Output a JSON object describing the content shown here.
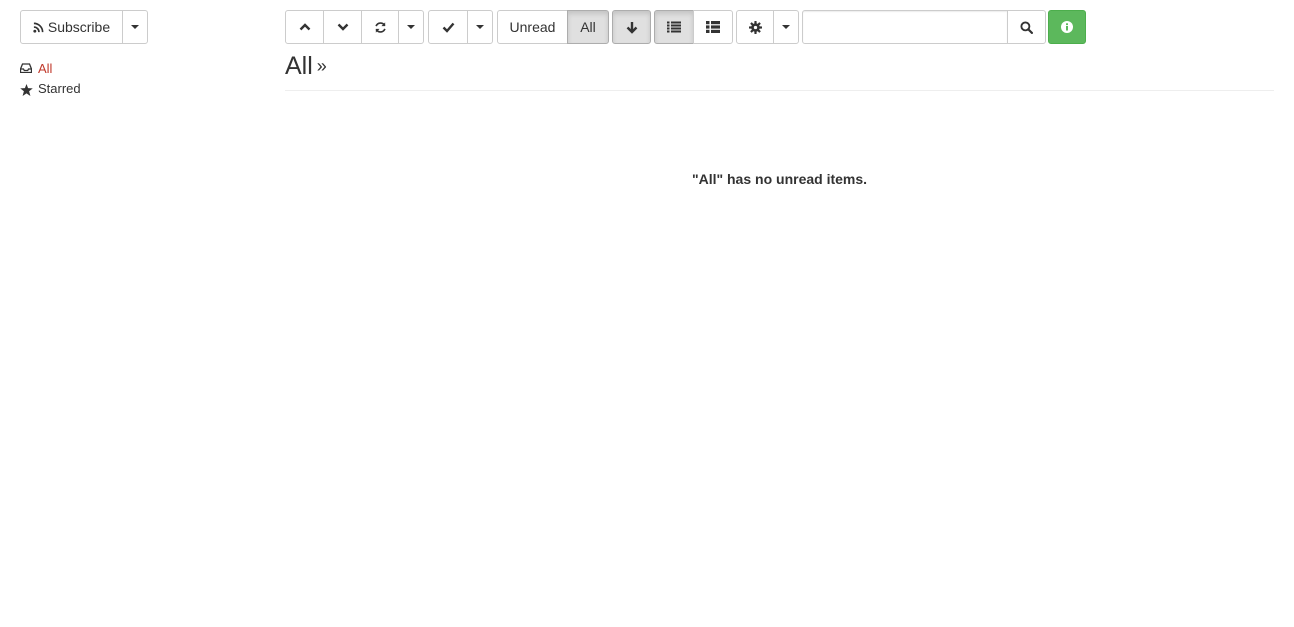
{
  "toolbar": {
    "subscribe_label": "Subscribe",
    "filter_unread_label": "Unread",
    "filter_all_label": "All",
    "search_placeholder": ""
  },
  "sidebar": {
    "items": [
      {
        "label": "All",
        "icon": "inbox-icon",
        "active": true
      },
      {
        "label": "Starred",
        "icon": "star-icon",
        "active": false
      }
    ]
  },
  "main": {
    "title": "All",
    "title_separator": "»",
    "empty_message": "\"All\" has no unread items."
  },
  "colors": {
    "accent_red": "#c0392b",
    "success_green": "#5cb85c",
    "active_button_bg": "#e0e0e0"
  }
}
